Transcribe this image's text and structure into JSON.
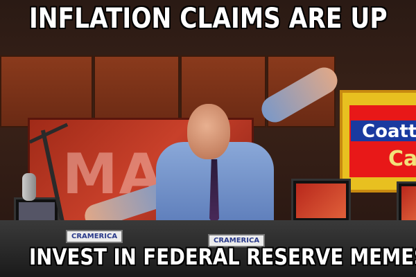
{
  "meme": {
    "top_text": "INFLATION CLAIMS ARE UP",
    "bottom_text": "INVEST IN FEDERAL RESERVE MEMES"
  },
  "scene": {
    "studio_sign_text": "MAD",
    "board_text_line1": "Coatt",
    "board_text_line2": "Ca",
    "nameplate_left": "CRAMERICA",
    "nameplate_center": "CRAMERICA"
  },
  "colors": {
    "caption_fill": "#ffffff",
    "caption_outline": "#000000",
    "studio_sign": "#c8402a",
    "shirt": "#8aa8d8"
  }
}
